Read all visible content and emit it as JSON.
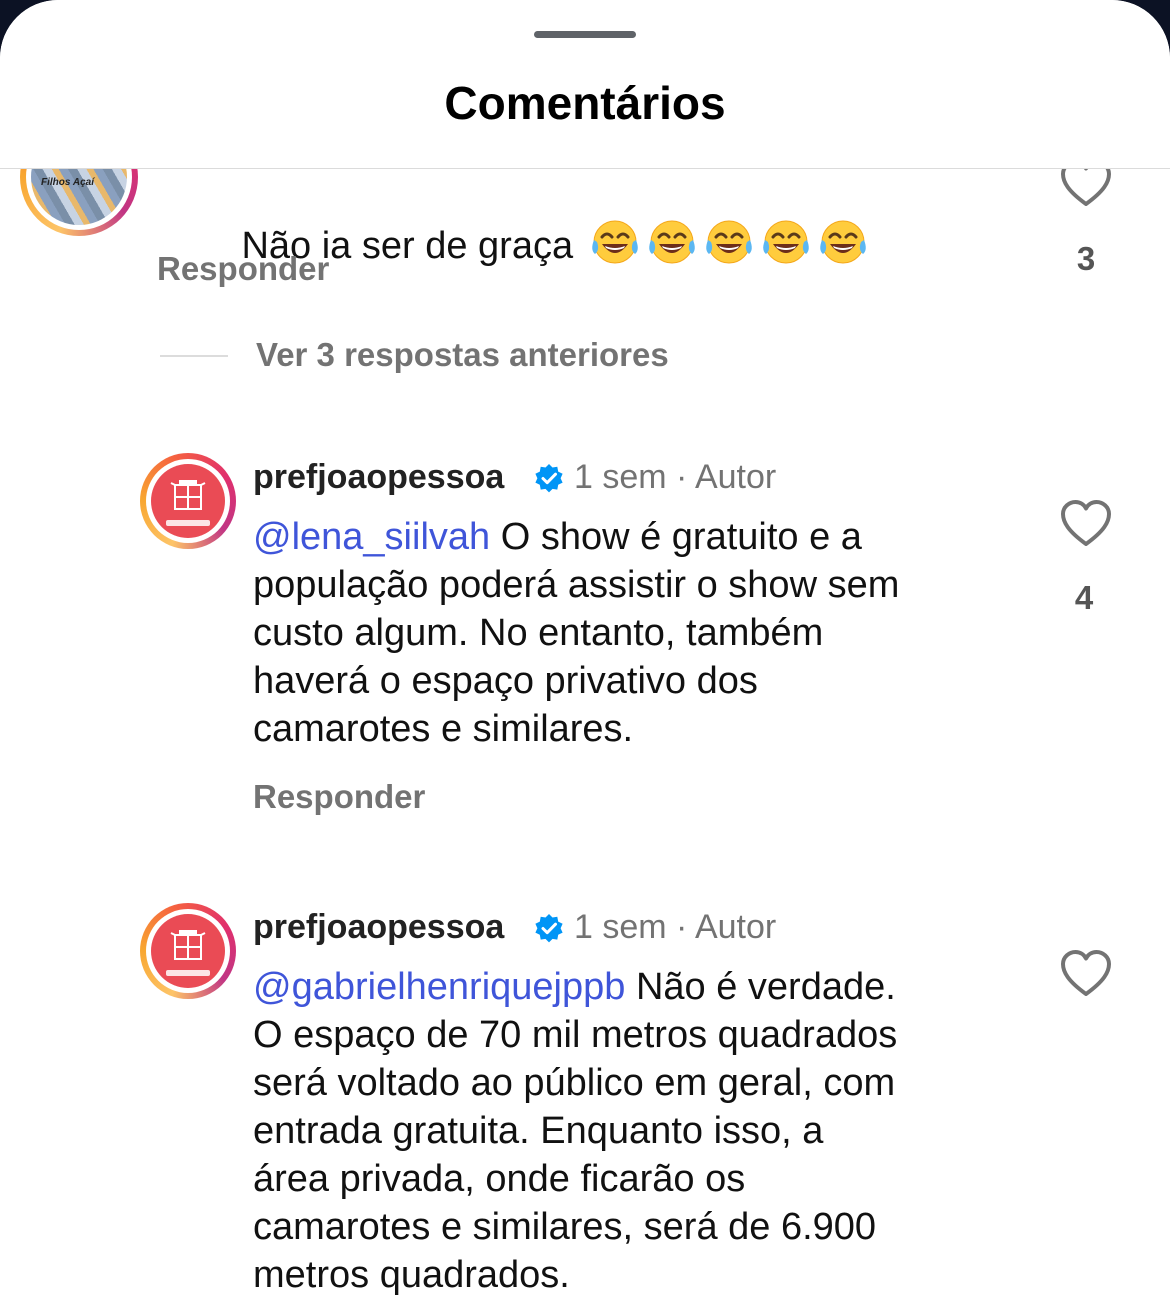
{
  "header": {
    "title": "Comentários"
  },
  "comments": [
    {
      "avatar_label": "Filhos Açaí",
      "text": "Não ia ser de graça",
      "emoji": "😂",
      "emoji_count": 5,
      "reply_label": "Responder",
      "likes": "3"
    },
    {
      "username": "prefjoaopessoa",
      "verified": true,
      "time": "1 sem",
      "separator": "·",
      "tag": "Autor",
      "mention": "@lena_siilvah",
      "text": " O show é gratuito e a\npopulação poderá assistir o show sem\ncusto algum. No entanto, também\nhaverá o espaço privativo dos\ncamarotes e similares.",
      "reply_label": "Responder",
      "likes": "4"
    },
    {
      "username": "prefjoaopessoa",
      "verified": true,
      "time": "1 sem",
      "separator": "·",
      "tag": "Autor",
      "mention": "@gabrielhenriquejppb",
      "text": " Não é verdade.\nO espaço de 70 mil metros quadrados\nserá voltado ao público em geral, com\nentrada gratuita. Enquanto isso, a\nárea privada, onde ficarão os\ncamarotes e similares, será de 6.900\nmetros quadrados."
    }
  ],
  "thread": {
    "view_replies": "Ver 3 respostas anteriores"
  },
  "colors": {
    "mention": "#3f55d9",
    "verified": "#0095f6",
    "secondary_text": "#737373"
  }
}
